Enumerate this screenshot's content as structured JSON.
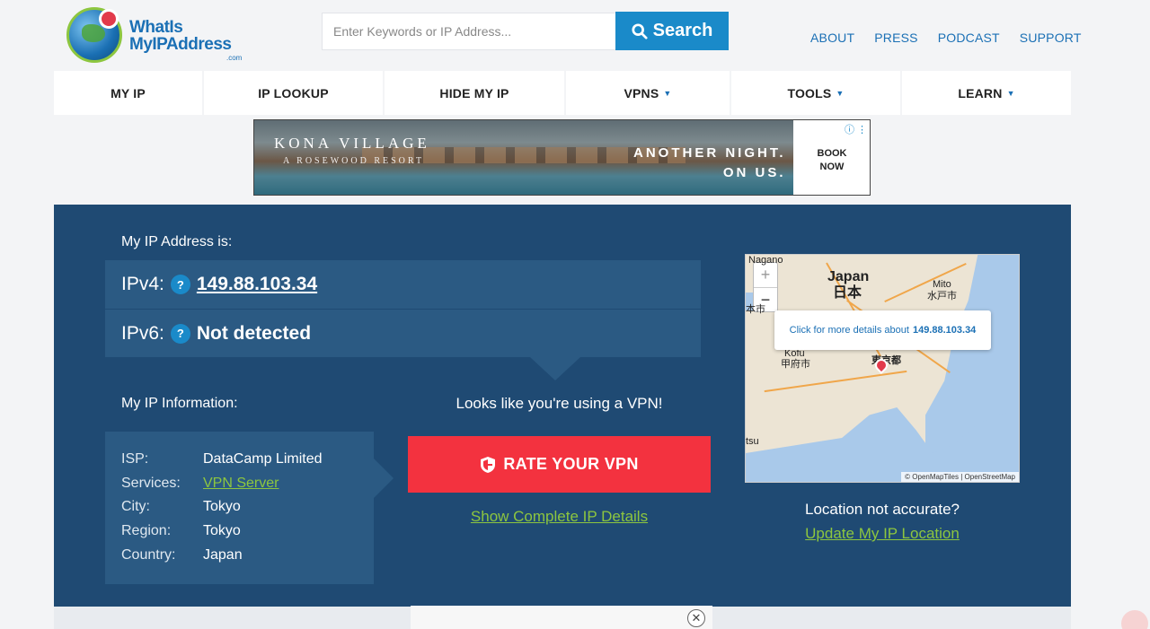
{
  "header": {
    "logo_line1": "WhatIs",
    "logo_line2": "MyIPAddress",
    "logo_com": ".com",
    "search_placeholder": "Enter Keywords or IP Address...",
    "search_button": "Search",
    "top_links": [
      "ABOUT",
      "PRESS",
      "PODCAST",
      "SUPPORT"
    ]
  },
  "nav": [
    {
      "label": "MY IP",
      "has_menu": false
    },
    {
      "label": "IP LOOKUP",
      "has_menu": false
    },
    {
      "label": "HIDE MY IP",
      "has_menu": false
    },
    {
      "label": "VPNS",
      "has_menu": true
    },
    {
      "label": "TOOLS",
      "has_menu": true
    },
    {
      "label": "LEARN",
      "has_menu": true
    }
  ],
  "ad": {
    "title": "KONA VILLAGE",
    "subtitle": "A ROSEWOOD RESORT",
    "tagline_1": "ANOTHER NIGHT.",
    "tagline_2": "ON US.",
    "book_1": "BOOK",
    "book_2": "NOW"
  },
  "ip": {
    "heading": "My IP Address is:",
    "ipv4_label": "IPv4:",
    "ipv4_value": "149.88.103.34",
    "ipv6_label": "IPv6:",
    "ipv6_value": "Not detected",
    "help_glyph": "?"
  },
  "info": {
    "heading": "My IP Information:",
    "rows": [
      {
        "key": "ISP:",
        "value": "DataCamp Limited"
      },
      {
        "key": "Services:",
        "value": "VPN Server"
      },
      {
        "key": "City:",
        "value": "Tokyo"
      },
      {
        "key": "Region:",
        "value": "Tokyo"
      },
      {
        "key": "Country:",
        "value": "Japan"
      }
    ]
  },
  "vpn": {
    "message": "Looks like you're using a VPN!",
    "rate_button": "RATE YOUR VPN",
    "complete_link": "Show Complete IP Details"
  },
  "map": {
    "zoom_in": "+",
    "zoom_out": "−",
    "labels": {
      "nagano": "Nagano",
      "japan_en": "Japan",
      "japan_jp": "日本",
      "mito_en": "Mito",
      "mito_jp": "水戸市",
      "kofu_en": "Kofu",
      "kofu_jp": "甲府市",
      "tokyo_jp": "東京都",
      "hon": "本市",
      "tsu": "tsu"
    },
    "popup_text": "Click for more details about",
    "popup_ip": "149.88.103.34",
    "attribution": "© OpenMapTiles | OpenStreetMap"
  },
  "location": {
    "question": "Location not accurate?",
    "update_link": "Update My IP Location"
  },
  "bottom": {
    "close_glyph": "✕"
  },
  "colors": {
    "panel": "#1f4a73",
    "panel_box": "#2b5a83",
    "accent_blue": "#1a8ac9",
    "rate_red": "#f3323f",
    "link_green": "#8dc63f"
  }
}
